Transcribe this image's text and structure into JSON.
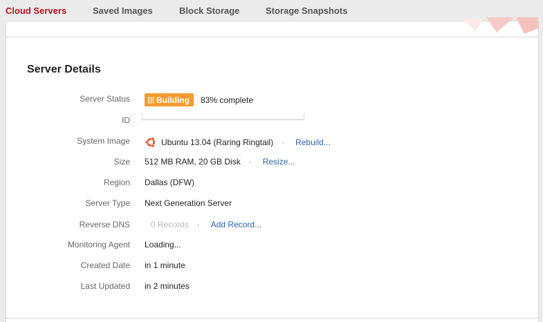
{
  "tabs": [
    {
      "label": "Cloud Servers",
      "active": true
    },
    {
      "label": "Saved Images",
      "active": false
    },
    {
      "label": "Block Storage",
      "active": false
    },
    {
      "label": "Storage Snapshots",
      "active": false
    }
  ],
  "section_title": "Server Details",
  "details": {
    "status": {
      "label": "Server Status",
      "badge": "Building",
      "progress_text": "83% complete",
      "progress": 0.83
    },
    "id": {
      "label": "ID",
      "value": ""
    },
    "image": {
      "label": "System Image",
      "value": "Ubuntu 13.04 (Raring Ringtail)",
      "action": "Rebuild...",
      "icon": "ubuntu-logo-icon"
    },
    "size": {
      "label": "Size",
      "value": "512 MB RAM, 20 GB Disk",
      "action": "Resize..."
    },
    "region": {
      "label": "Region",
      "value": "Dallas (DFW)"
    },
    "server_type": {
      "label": "Server Type",
      "value": "Next Generation Server"
    },
    "reverse_dns": {
      "label": "Reverse DNS",
      "value": "0 Records",
      "action": "Add Record..."
    },
    "monitoring": {
      "label": "Monitoring Agent",
      "value": "Loading..."
    },
    "created": {
      "label": "Created Date",
      "value": "in 1 minute"
    },
    "updated": {
      "label": "Last Updated",
      "value": "in 2 minutes"
    }
  },
  "separator": "·",
  "colors": {
    "active_tab": "#b5131a",
    "badge": "#f39b2f",
    "link": "#2a63ad",
    "label": "#666666",
    "ubuntu_orange": "#dd4814"
  }
}
